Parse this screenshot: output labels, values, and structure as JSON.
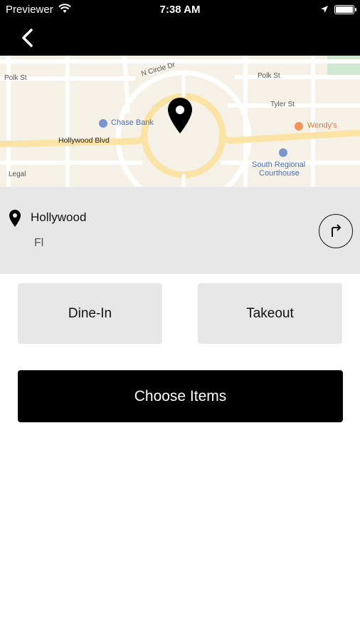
{
  "status_bar": {
    "carrier": "Previewer",
    "time": "7:38 AM"
  },
  "map": {
    "labels": {
      "polk_st_left": "Polk St",
      "n_circle_dr": "N Circle Dr",
      "polk_st_right": "Polk St",
      "tyler_st": "Tyler St",
      "chase_bank": "Chase Bank",
      "wendys": "Wendy's",
      "hollywood_blvd": "Hollywood Blvd",
      "south_regional": "South Regional",
      "courthouse": "Courthouse",
      "legal": "Legal"
    },
    "colors": {
      "background": "#f5f1e6",
      "road": "#ffffff",
      "main_road": "#fbe3a6",
      "park": "#cfe8d0"
    }
  },
  "location": {
    "name": "Hollywood",
    "state": "Fl"
  },
  "order_options": {
    "dine_in": "Dine-In",
    "takeout": "Takeout"
  },
  "primary_action": {
    "label": "Choose Items"
  },
  "icons": {
    "back": "chevron-left-icon",
    "map_pin": "map-pin-icon",
    "location_pin": "location-pin-icon",
    "directions": "turn-right-arrow-icon",
    "wifi": "wifi-icon",
    "location_services": "location-arrow-icon",
    "battery": "battery-icon"
  }
}
